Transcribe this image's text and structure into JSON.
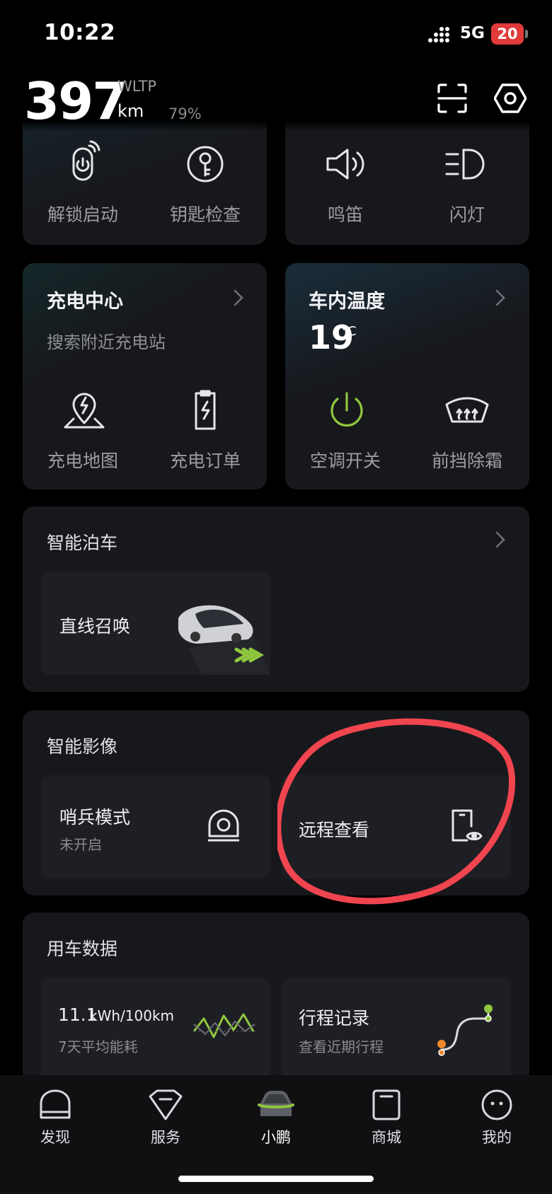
{
  "status_bar": {
    "time": "10:22",
    "network": "5G",
    "battery": "20"
  },
  "header": {
    "range": "397",
    "standard": "WLTP",
    "unit": "km",
    "battery_pct": "79%"
  },
  "quick_controls": {
    "left": [
      {
        "label": "解锁启动",
        "icon": "phone-power-icon"
      },
      {
        "label": "钥匙检查",
        "icon": "key-icon"
      }
    ],
    "right": [
      {
        "label": "鸣笛",
        "icon": "horn-icon"
      },
      {
        "label": "闪灯",
        "icon": "headlight-icon"
      }
    ]
  },
  "charging": {
    "title": "充电中心",
    "subtitle": "搜索附近充电站",
    "items": [
      {
        "label": "充电地图",
        "icon": "charge-map-icon"
      },
      {
        "label": "充电订单",
        "icon": "charge-order-icon"
      }
    ]
  },
  "climate": {
    "title": "车内温度",
    "temperature": "19",
    "unit": "°C",
    "items": [
      {
        "label": "空调开关",
        "icon": "power-icon"
      },
      {
        "label": "前挡除霜",
        "icon": "defrost-icon"
      }
    ]
  },
  "parking": {
    "title": "智能泊车",
    "tile": "直线召唤"
  },
  "imaging": {
    "title": "智能影像",
    "sentry": {
      "title": "哨兵模式",
      "status": "未开启"
    },
    "remote": {
      "title": "远程查看"
    }
  },
  "vehicle_data": {
    "title": "用车数据",
    "energy": {
      "value": "11.1",
      "unit": "kWh/100km",
      "subtitle": "7天平均能耗"
    },
    "trips": {
      "title": "行程记录",
      "subtitle": "查看近期行程"
    }
  },
  "nav": [
    {
      "label": "发现"
    },
    {
      "label": "服务"
    },
    {
      "label": "小鹏",
      "active": true
    },
    {
      "label": "商城"
    },
    {
      "label": "我的"
    }
  ],
  "colors": {
    "accent_green": "#8fc73e",
    "annotation_red": "#f0454f",
    "battery_red": "#e03a3a"
  }
}
